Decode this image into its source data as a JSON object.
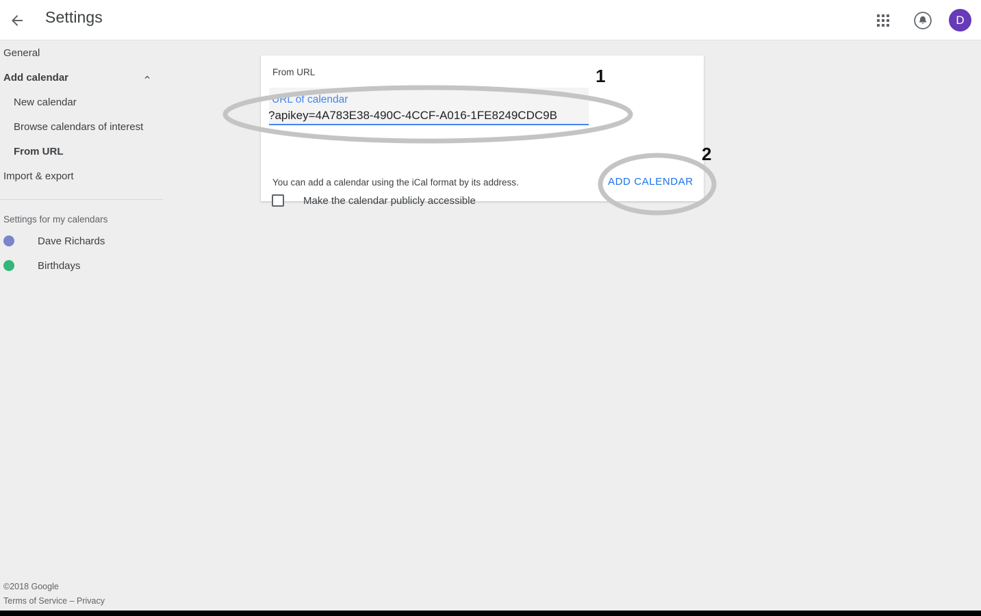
{
  "topbar": {
    "back_icon": "arrow-back-icon",
    "title": "Settings",
    "apps_icon": "apps-grid-icon",
    "notifications_icon": "bell-icon",
    "avatar_initial": "D"
  },
  "sidebar": {
    "items": [
      {
        "label": "General",
        "level": 0,
        "selected": false,
        "expander": null
      },
      {
        "label": "Add calendar",
        "level": 0,
        "selected": true,
        "expander": "chevron-up-icon"
      },
      {
        "label": "New calendar",
        "level": 1,
        "selected": false,
        "expander": null
      },
      {
        "label": "Browse calendars of interest",
        "level": 1,
        "selected": false,
        "expander": null
      },
      {
        "label": "From URL",
        "level": 1,
        "selected": true,
        "expander": null
      },
      {
        "label": "Import & export",
        "level": 0,
        "selected": false,
        "expander": null
      }
    ],
    "section_label": "Settings for my calendars",
    "calendars": [
      {
        "name": "Dave Richards",
        "color": "#7986cb"
      },
      {
        "name": "Birthdays",
        "color": "#33b679"
      }
    ]
  },
  "footer": {
    "copyright": "©2018 Google",
    "terms": "Terms of Service",
    "separator": " – ",
    "privacy": "Privacy"
  },
  "card": {
    "heading": "From URL",
    "url_field": {
      "label": "URL of calendar",
      "value": "?apikey=4A783E38-490C-4CCF-A016-1FE8249CDC9B",
      "placeholder": "URL of calendar",
      "focused": true
    },
    "checkbox": {
      "label": "Make the calendar publicly accessible",
      "checked": false
    },
    "hint": "You can add a calendar using the iCal format by its address.",
    "add_button": "ADD CALENDAR"
  },
  "annotations": [
    {
      "number": "1",
      "target": "url-of-calendar-field"
    },
    {
      "number": "2",
      "target": "add-calendar-button"
    }
  ],
  "colors": {
    "accent_blue": "#4285f4",
    "link_blue": "#1a73e8",
    "avatar_purple": "#673ab7",
    "annotation_gray": "#c4c4c4",
    "page_bg": "#eeeeee"
  }
}
